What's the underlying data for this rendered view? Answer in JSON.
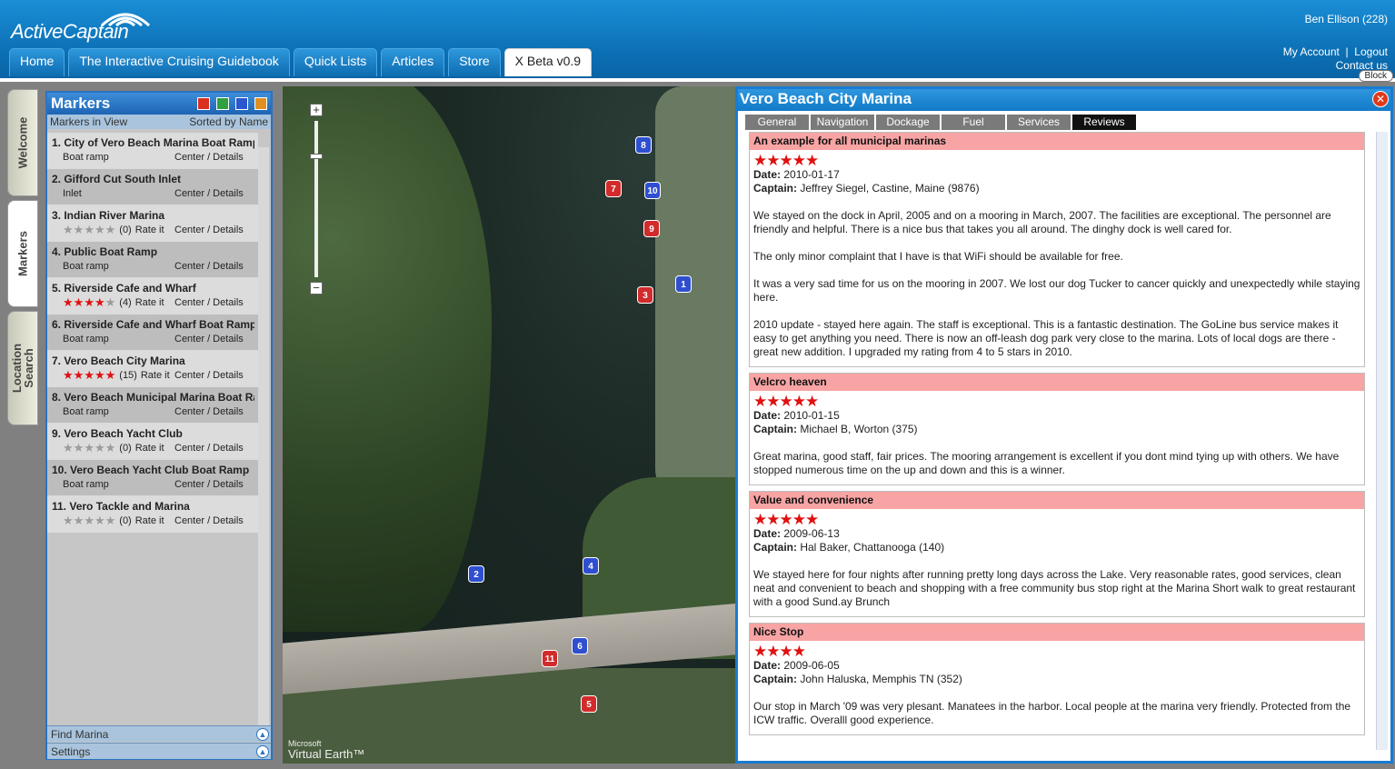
{
  "app": {
    "logo_text": "ActiveCaptain",
    "user": "Ben Ellison (228)",
    "my_account": "My Account",
    "separator": "|",
    "logout": "Logout",
    "contact": "Contact us",
    "block": "Block"
  },
  "nav": [
    "Home",
    "The Interactive Cruising Guidebook",
    "Quick Lists",
    "Articles",
    "Store",
    "X Beta v0.9"
  ],
  "side_tabs": {
    "welcome": "Welcome",
    "markers": "Markers",
    "location": "Location\nSearch"
  },
  "markers_panel": {
    "title": "Markers",
    "colors": [
      "#d93020",
      "#30a040",
      "#2a56d0",
      "#e09020"
    ],
    "in_view": "Markers in View",
    "sorted": "Sorted by Name",
    "center_details": "Center / Details",
    "items": [
      {
        "title": "1. City of Vero Beach Marina Boat Ramp",
        "type": "Boat ramp"
      },
      {
        "title": "2. Gifford Cut South Inlet",
        "type": "Inlet"
      },
      {
        "title": "3. Indian River Marina",
        "stars": 0,
        "count": "(0)",
        "rate": "Rate it"
      },
      {
        "title": "4. Public Boat Ramp",
        "type": "Boat ramp"
      },
      {
        "title": "5. Riverside Cafe and Wharf",
        "stars": 4,
        "count": "(4)",
        "rate": "Rate it"
      },
      {
        "title": "6. Riverside Cafe and Wharf Boat Ramp",
        "type": "Boat ramp"
      },
      {
        "title": "7. Vero Beach City Marina",
        "stars": 5,
        "count": "(15)",
        "rate": "Rate it"
      },
      {
        "title": "8. Vero Beach Municipal Marina Boat Ra",
        "type": "Boat ramp"
      },
      {
        "title": "9. Vero Beach Yacht Club",
        "stars": 0,
        "count": "(0)",
        "rate": "Rate it"
      },
      {
        "title": "10. Vero Beach Yacht Club Boat Ramp",
        "type": "Boat ramp"
      },
      {
        "title": "11. Vero Tackle and Marina",
        "stars": 0,
        "count": "(0)",
        "rate": "Rate it"
      }
    ],
    "find_marina": "Find Marina",
    "settings": "Settings"
  },
  "map": {
    "zoom_in": "+",
    "zoom_out": "−",
    "brand_small": "Microsoft",
    "brand": "Virtual Earth™",
    "pins": [
      {
        "label": "1",
        "color": "blue"
      },
      {
        "label": "2",
        "color": "blue"
      },
      {
        "label": "3",
        "color": "red"
      },
      {
        "label": "4",
        "color": "blue"
      },
      {
        "label": "5",
        "color": "red"
      },
      {
        "label": "6",
        "color": "blue"
      },
      {
        "label": "7",
        "color": "red"
      },
      {
        "label": "8",
        "color": "blue"
      },
      {
        "label": "9",
        "color": "red"
      },
      {
        "label": "10",
        "color": "blue"
      },
      {
        "label": "11",
        "color": "red"
      }
    ]
  },
  "detail": {
    "title": "Vero Beach City Marina",
    "close": "✕",
    "tabs": [
      "General",
      "Navigation",
      "Dockage",
      "Fuel",
      "Services",
      "Reviews"
    ],
    "active_tab": "Reviews",
    "date_label": "Date:",
    "captain_label": "Captain:",
    "reviews": [
      {
        "title": "An example for all municipal marinas",
        "stars": 5,
        "date": "2010-01-17",
        "captain": "Jeffrey Siegel, Castine, Maine (9876)",
        "paragraphs": [
          "We stayed on the dock in April, 2005 and on a mooring in March, 2007. The facilities are exceptional. The personnel are friendly and helpful. There is a nice bus that takes you all around. The dinghy dock is well cared for.",
          "The only minor complaint that I have is that WiFi should be available for free.",
          "It was a very sad time for us on the mooring in 2007.  We lost our dog Tucker to cancer quickly and unexpectedly while staying here.",
          "2010 update - stayed here again.  The staff is exceptional.  This is a fantastic destination.  The GoLine bus service makes it easy to get anything you need.  There is now an off-leash dog park very close to the marina.  Lots of local dogs are there - great new addition.  I upgraded my rating from 4 to 5 stars in 2010."
        ]
      },
      {
        "title": "Velcro heaven",
        "stars": 5,
        "date": "2010-01-15",
        "captain": "Michael B, Worton (375)",
        "paragraphs": [
          "Great marina, good staff, fair prices. The mooring arrangement is excellent if you dont mind tying up with others. We have stopped numerous time on the up and down and this is a winner."
        ]
      },
      {
        "title": "Value and convenience",
        "stars": 5,
        "date": "2009-06-13",
        "captain": "Hal Baker, Chattanooga (140)",
        "paragraphs": [
          "We stayed here for four nights after running pretty long days across the Lake.  Very reasonable rates, good services, clean neat and convenient to beach and shopping with a free community bus stop right at the Marina  Short walk to great restaurant with a good Sund.ay Brunch"
        ]
      },
      {
        "title": "Nice Stop",
        "stars": 4,
        "date": "2009-06-05",
        "captain": "John Haluska, Memphis TN (352)",
        "paragraphs": [
          "Our stop in March '09 was very plesant.  Manatees in the harbor. Local people at the marina very friendly.  Protected from the ICW traffic.  Overalll good experience."
        ]
      }
    ]
  }
}
